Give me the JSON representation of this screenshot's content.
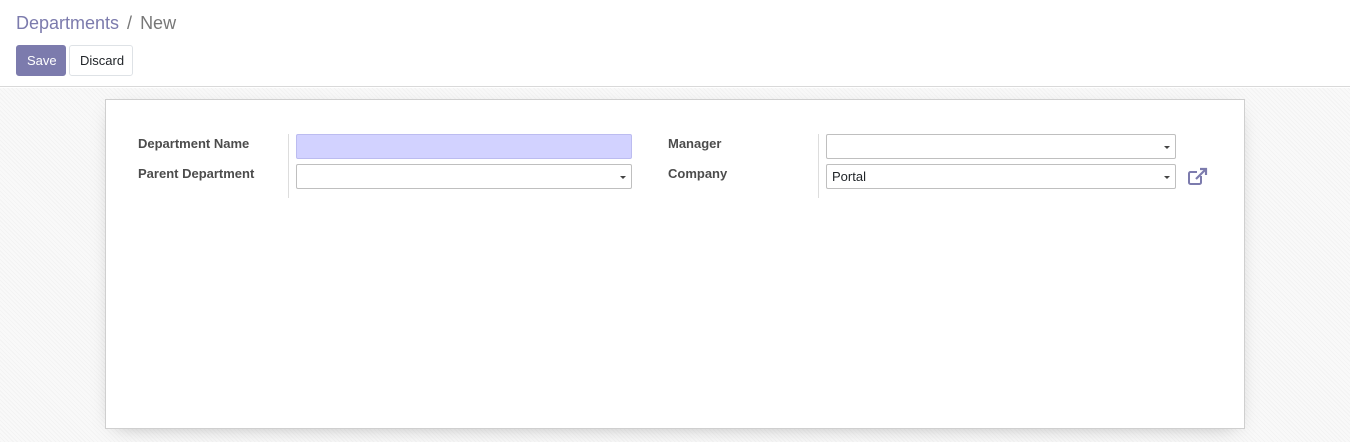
{
  "breadcrumb": {
    "parent": "Departments",
    "separator": "/",
    "current": "New"
  },
  "toolbar": {
    "save_label": "Save",
    "discard_label": "Discard"
  },
  "form": {
    "department_name": {
      "label": "Department Name",
      "value": ""
    },
    "parent_department": {
      "label": "Parent Department",
      "value": ""
    },
    "manager": {
      "label": "Manager",
      "value": ""
    },
    "company": {
      "label": "Company",
      "value": "Portal"
    }
  },
  "icons": {
    "dropdown": "chevron-down-icon",
    "external_link": "external-link-icon"
  },
  "colors": {
    "brand": "#7c7bad",
    "required_field": "#d2d2ff"
  }
}
